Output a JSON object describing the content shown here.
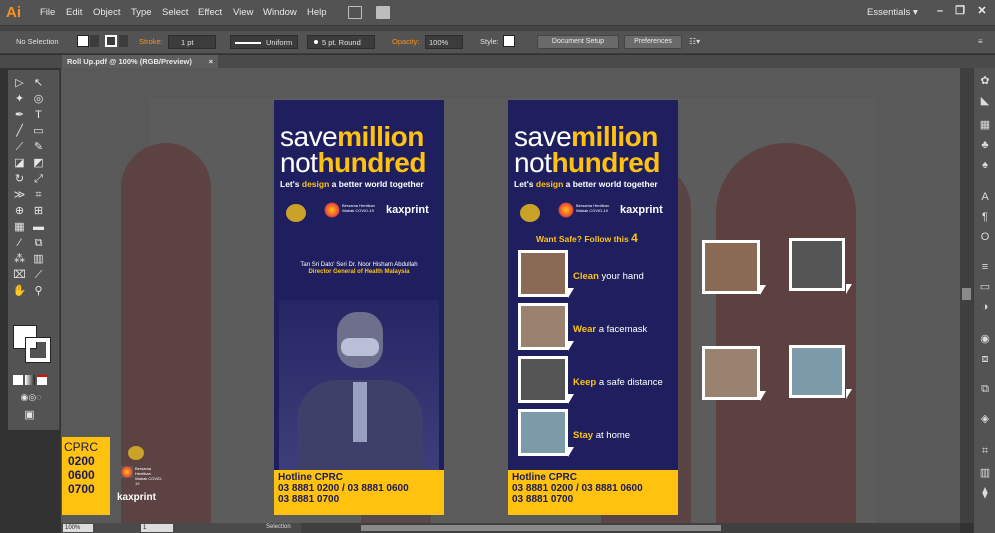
{
  "menubar": {
    "logo": "Ai",
    "items": [
      "File",
      "Edit",
      "Object",
      "Type",
      "Select",
      "Effect",
      "View",
      "Window",
      "Help"
    ],
    "workspace": "Essentials",
    "workspace_caret": "▾",
    "win_minimize": "–",
    "win_restore": "❐",
    "win_close": "✕"
  },
  "controlbar": {
    "selection": "No Selection",
    "stroke_label": "Stroke:",
    "stroke_value": "1 pt",
    "uniform": "Uniform",
    "brush": "5 pt. Round",
    "opacity_label": "Opacity:",
    "opacity_value": "100%",
    "style_label": "Style:",
    "document_setup": "Document Setup",
    "preferences": "Preferences"
  },
  "tab": {
    "title": "Roll Up.pdf @ 100% (RGB/Preview)",
    "close": "×"
  },
  "banner_left": {
    "h1_line1_a": "save",
    "h1_line1_b": "million",
    "h1_line2_a": "not",
    "h1_line2_b": "hundred",
    "sub_a": "Let's ",
    "sub_b": "design",
    "sub_c": " a better world together",
    "logo_text": "kaxprint",
    "covid_text": "Bersama Hentikan Wabak COVID-19",
    "person_name": "Tan Sri Dato' Seri Dr. Noor Hisham Abdullah",
    "person_title": "Director General of Health Malaysia",
    "hotline_title": "Hotline CPRC",
    "hotline_line1": "03 8881 0200 / 03 8881 0600",
    "hotline_line2": "03 8881 0700"
  },
  "banner_right": {
    "h1_line1_a": "save",
    "h1_line1_b": "million",
    "h1_line2_a": "not",
    "h1_line2_b": "hundred",
    "sub_a": "Let's ",
    "sub_b": "design",
    "sub_c": " a better world together",
    "logo_text": "kaxprint",
    "covid_text": "Bersama Hentikan Wabak COVID-19",
    "follow_a": "Want Safe? Follow this ",
    "follow_b": "4",
    "steps": [
      {
        "bold": "Clean",
        "rest": " your hand"
      },
      {
        "bold": "Wear",
        "rest": " a facemask"
      },
      {
        "bold": "Keep",
        "rest": " a safe distance"
      },
      {
        "bold": "Stay",
        "rest": " at home"
      }
    ],
    "hotline_title": "Hotline CPRC",
    "hotline_line1": "03 8881 0200 / 03 8881 0600",
    "hotline_line2": "03 8881 0700"
  },
  "side_piece": {
    "title": "CPRC",
    "n1": "0200",
    "n2": "0600",
    "n3": "0700",
    "logo_text": "kaxprint",
    "covid_text": "Bersama Hentikan Wabak COVID-19"
  },
  "statusbar": {
    "zoom": "100%",
    "page": "1",
    "tool": "Selection"
  },
  "colors": {
    "navy": "#1f1f5f",
    "yellow": "#ffc20e",
    "ai_orange": "#f7931e"
  }
}
